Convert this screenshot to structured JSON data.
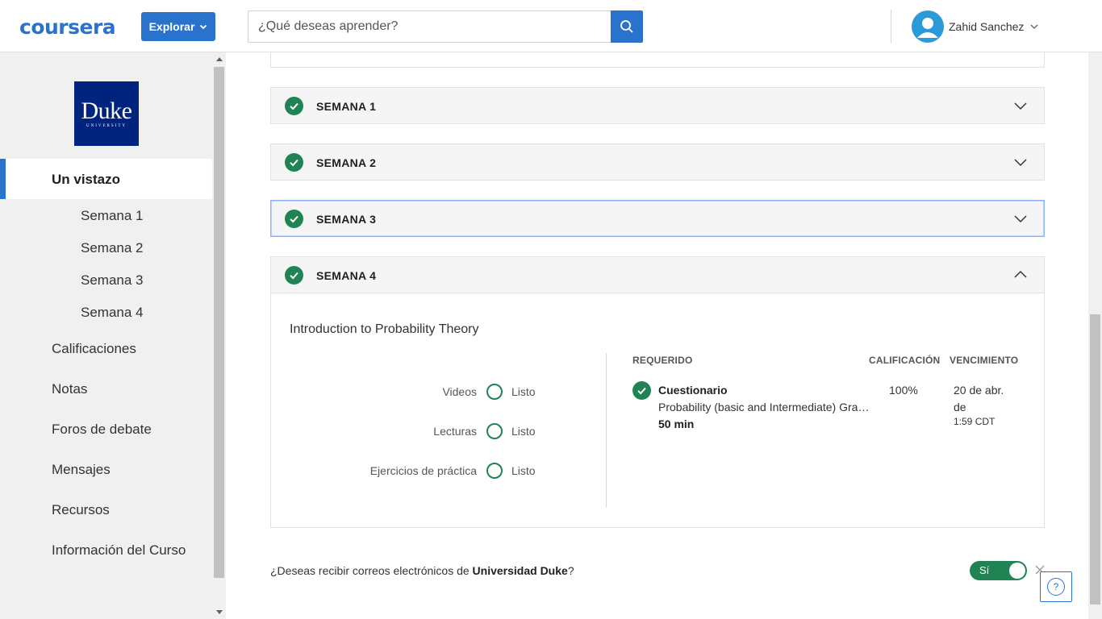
{
  "header": {
    "logo": "coursera",
    "explore_label": "Explorar",
    "search_placeholder": "¿Qué deseas aprender?",
    "user_name": "Zahid Sanchez"
  },
  "sidebar": {
    "logo_text": "Duke",
    "logo_subtext": "UNIVERSITY",
    "active_item": "Un vistazo",
    "weeks": [
      "Semana 1",
      "Semana 2",
      "Semana 3",
      "Semana 4"
    ],
    "items": [
      "Calificaciones",
      "Notas",
      "Foros de debate",
      "Mensajes",
      "Recursos",
      "Información del Curso"
    ]
  },
  "weeks": [
    {
      "label": "SEMANA 1",
      "completed": true,
      "expanded": false
    },
    {
      "label": "SEMANA 2",
      "completed": true,
      "expanded": false
    },
    {
      "label": "SEMANA 3",
      "completed": true,
      "expanded": false
    },
    {
      "label": "SEMANA 4",
      "completed": true,
      "expanded": true
    }
  ],
  "week4": {
    "module_title": "Introduction to Probability Theory",
    "stats": [
      {
        "label": "Videos",
        "value": "Listo"
      },
      {
        "label": "Lecturas",
        "value": "Listo"
      },
      {
        "label": "Ejercicios de práctica",
        "value": "Listo"
      }
    ],
    "table_headers": {
      "required": "REQUERIDO",
      "grade": "CALIFICACIÓN",
      "due": "VENCIMIENTO"
    },
    "item": {
      "type": "Cuestionario",
      "description": "Probability (basic and Intermediate) Graded Quiz",
      "duration": "50 min",
      "grade": "100%",
      "due_line1": "20 de abr.",
      "due_line2": "de",
      "due_time": "1:59 CDT"
    }
  },
  "email_prompt": {
    "prefix": "¿Deseas recibir correos electrónicos de ",
    "university": "Universidad Duke",
    "suffix": "?",
    "toggle_label": "Sí"
  },
  "colors": {
    "brand_blue": "#2a73cc",
    "success_green": "#1f8354"
  }
}
